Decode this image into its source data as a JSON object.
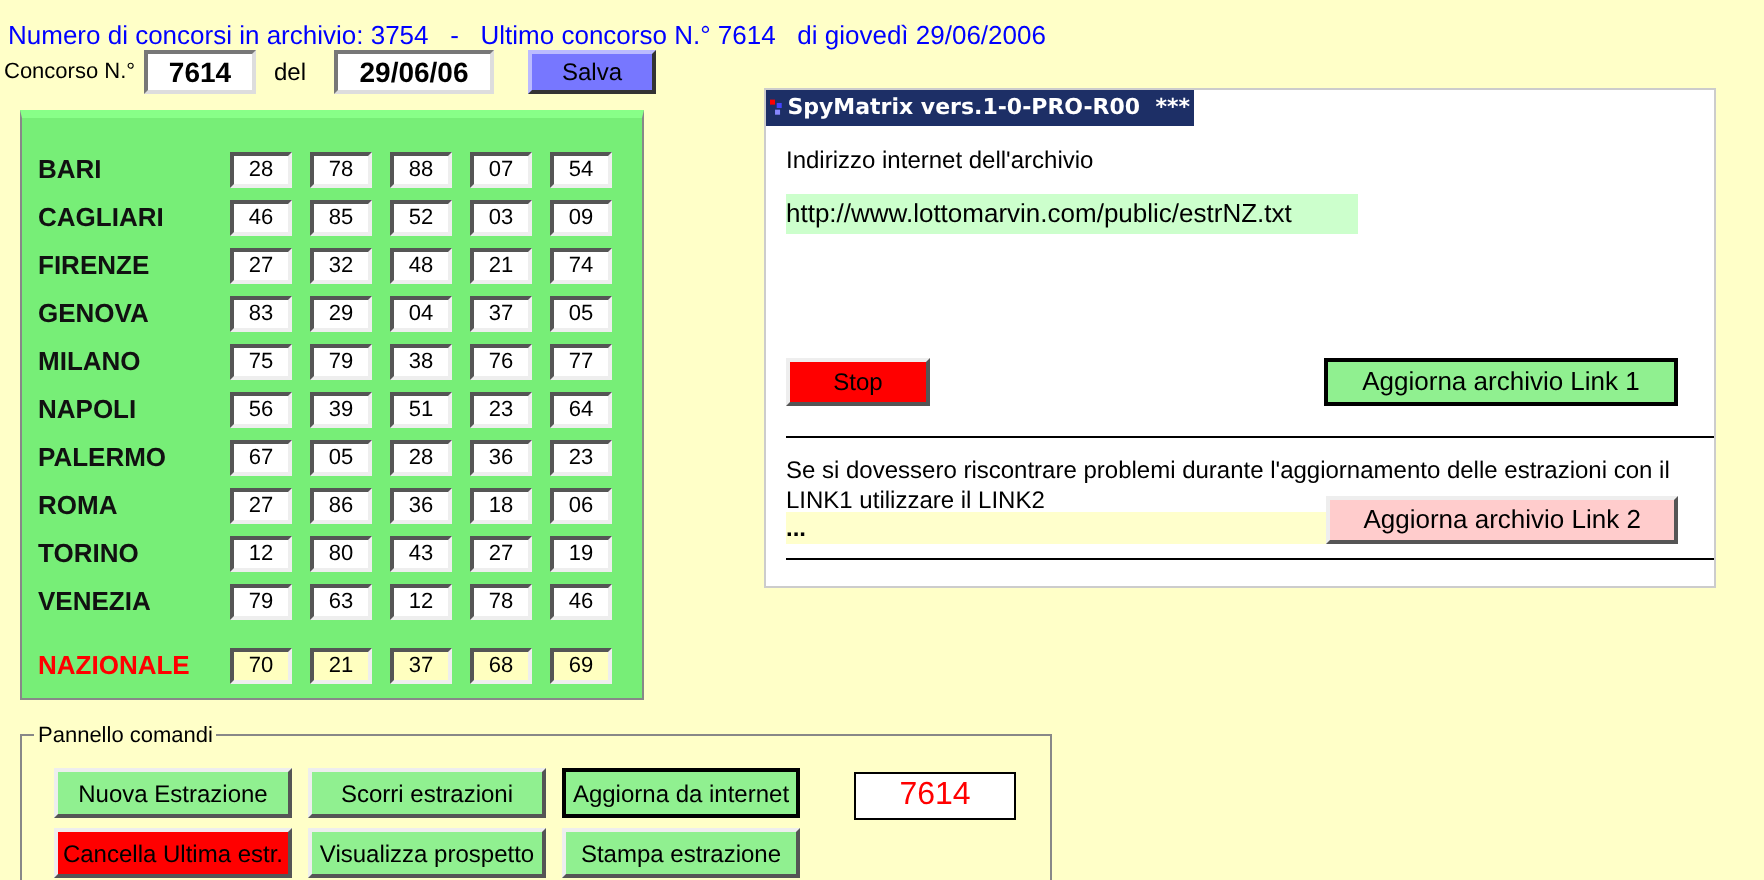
{
  "header": {
    "summary": "Numero di concorsi in archivio: 3754   -   Ultimo concorso N.° 7614   di giovedì 29/06/2006"
  },
  "form": {
    "number_label": "Concorso N.°",
    "number": "7614",
    "date_label": "del",
    "date": "29/06/06",
    "save": "Salva"
  },
  "wheels": [
    {
      "name": "BARI",
      "kind": "regular",
      "numbers": [
        "28",
        "78",
        "88",
        "07",
        "54"
      ]
    },
    {
      "name": "CAGLIARI",
      "kind": "regular",
      "numbers": [
        "46",
        "85",
        "52",
        "03",
        "09"
      ]
    },
    {
      "name": "FIRENZE",
      "kind": "regular",
      "numbers": [
        "27",
        "32",
        "48",
        "21",
        "74"
      ]
    },
    {
      "name": "GENOVA",
      "kind": "regular",
      "numbers": [
        "83",
        "29",
        "04",
        "37",
        "05"
      ]
    },
    {
      "name": "MILANO",
      "kind": "regular",
      "numbers": [
        "75",
        "79",
        "38",
        "76",
        "77"
      ]
    },
    {
      "name": "NAPOLI",
      "kind": "regular",
      "numbers": [
        "56",
        "39",
        "51",
        "23",
        "64"
      ]
    },
    {
      "name": "PALERMO",
      "kind": "regular",
      "numbers": [
        "67",
        "05",
        "28",
        "36",
        "23"
      ]
    },
    {
      "name": "ROMA",
      "kind": "regular",
      "numbers": [
        "27",
        "86",
        "36",
        "18",
        "06"
      ]
    },
    {
      "name": "TORINO",
      "kind": "regular",
      "numbers": [
        "12",
        "80",
        "43",
        "27",
        "19"
      ]
    },
    {
      "name": "VENEZIA",
      "kind": "regular",
      "numbers": [
        "79",
        "63",
        "12",
        "78",
        "46"
      ]
    },
    {
      "name": "NAZIONALE",
      "kind": "national",
      "numbers": [
        "70",
        "21",
        "37",
        "68",
        "69"
      ]
    }
  ],
  "command_panel": {
    "title": "Pannello comandi",
    "buttons": [
      {
        "label": "Nuova Estrazione",
        "kind": "green",
        "focused": false
      },
      {
        "label": "Scorri estrazioni",
        "kind": "green",
        "focused": false
      },
      {
        "label": "Aggiorna da internet",
        "kind": "green",
        "focused": true
      },
      {
        "label": "Cancella Ultima estr.",
        "kind": "red",
        "focused": false
      },
      {
        "label": "Visualizza prospetto",
        "kind": "green",
        "focused": false
      },
      {
        "label": "Stampa estrazione",
        "kind": "green",
        "focused": false
      }
    ],
    "counter": "7614"
  },
  "dialog": {
    "title": "SpyMatrix vers.1-0-PRO-R00  ***",
    "address_label": "Indirizzo internet dell'archivio",
    "address": "http://www.lottomarvin.com/public/estrNZ.txt",
    "buttons": [
      {
        "label": "Stop",
        "kind": "red",
        "focused": false
      },
      {
        "label": "Aggiorna archivio Link 1",
        "kind": "green",
        "focused": true
      }
    ],
    "note": "Se si dovessero riscontrare problemi durante l'aggiornamento delle estrazioni con il LINK1 utilizzare il LINK2",
    "status": "...",
    "link2_button": {
      "label": "Aggiorna archivio Link 2",
      "kind": "pink",
      "focused": false
    }
  }
}
